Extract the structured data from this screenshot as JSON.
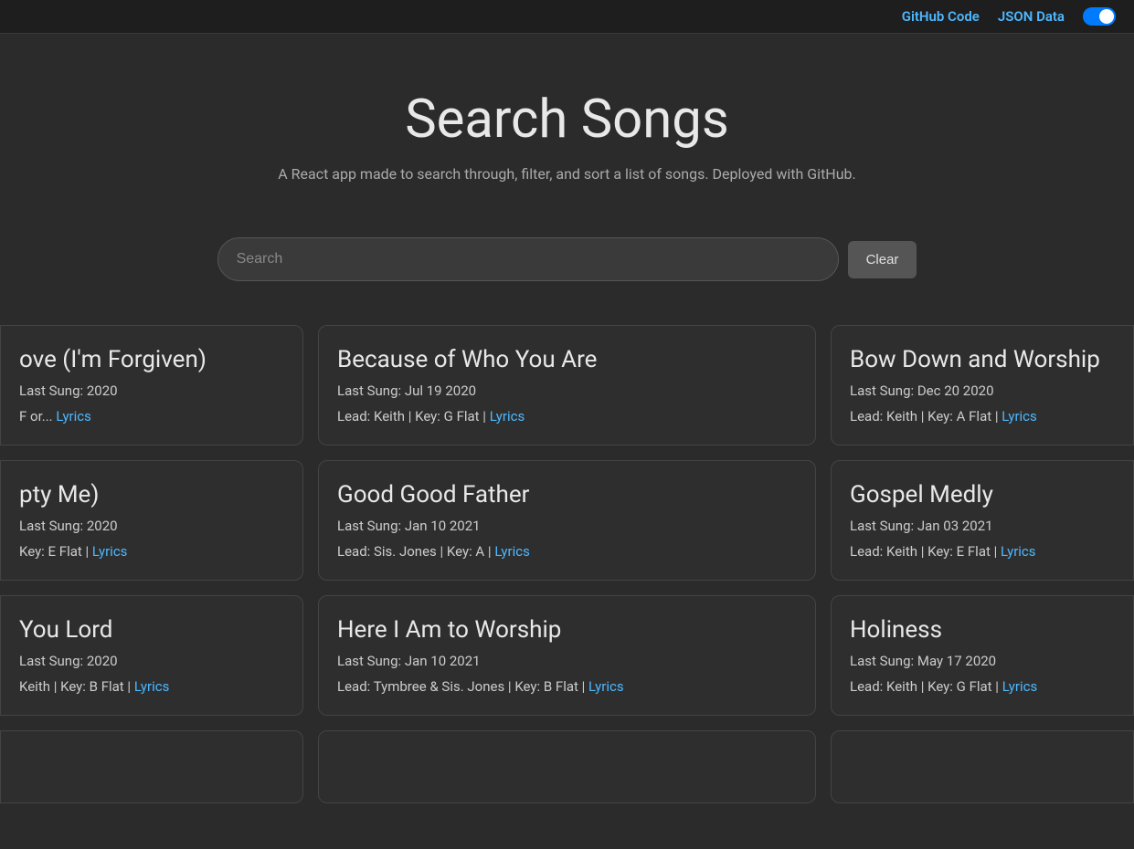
{
  "nav": {
    "github_label": "GitHub Code",
    "json_label": "JSON Data"
  },
  "hero": {
    "title": "Search Songs",
    "subtitle": "A React app made to search through, filter, and sort a list of songs. Deployed with GitHub."
  },
  "search": {
    "placeholder": "Search",
    "clear_label": "Clear"
  },
  "songs": [
    {
      "title": "ove (I'm Forgiven)",
      "date": "Last Sung: 2020",
      "meta": "F or...",
      "lyrics_label": "Lyrics",
      "partial": "left"
    },
    {
      "title": "Because of Who You Are",
      "date": "Last Sung: Jul 19 2020",
      "meta": "Lead: Keith | Key: G Flat |",
      "lyrics_label": "Lyrics",
      "partial": ""
    },
    {
      "title": "Bow Down and Worship",
      "date": "Last Sung: Dec 20 2020",
      "meta": "Lead: Keith | Key: A Flat |",
      "lyrics_label": "Lyrics",
      "partial": "right"
    },
    {
      "title": "pty Me)",
      "date": "Last Sung: 2020",
      "meta": "Key: E Flat |",
      "lyrics_label": "Lyrics",
      "partial": "left"
    },
    {
      "title": "Good Good Father",
      "date": "Last Sung: Jan 10 2021",
      "meta": "Lead: Sis. Jones | Key: A |",
      "lyrics_label": "Lyrics",
      "partial": ""
    },
    {
      "title": "Gospel Medly",
      "date": "Last Sung: Jan 03 2021",
      "meta": "Lead: Keith | Key: E Flat |",
      "lyrics_label": "Lyrics",
      "partial": "right"
    },
    {
      "title": "You Lord",
      "date": "Last Sung: 2020",
      "meta": "Keith | Key: B Flat |",
      "lyrics_label": "Lyrics",
      "partial": "left"
    },
    {
      "title": "Here I Am to Worship",
      "date": "Last Sung: Jan 10 2021",
      "meta": "Lead: Tymbree & Sis. Jones | Key: B Flat |",
      "lyrics_label": "Lyrics",
      "partial": ""
    },
    {
      "title": "Holiness",
      "date": "Last Sung: May 17 2020",
      "meta": "Lead: Keith | Key: G Flat |",
      "lyrics_label": "Lyrics",
      "partial": "right"
    },
    {
      "title": "...",
      "date": "",
      "meta": "",
      "lyrics_label": "",
      "partial": "left"
    },
    {
      "title": "...",
      "date": "",
      "meta": "",
      "lyrics_label": "",
      "partial": ""
    },
    {
      "title": "...",
      "date": "",
      "meta": "",
      "lyrics_label": "",
      "partial": "right"
    }
  ]
}
